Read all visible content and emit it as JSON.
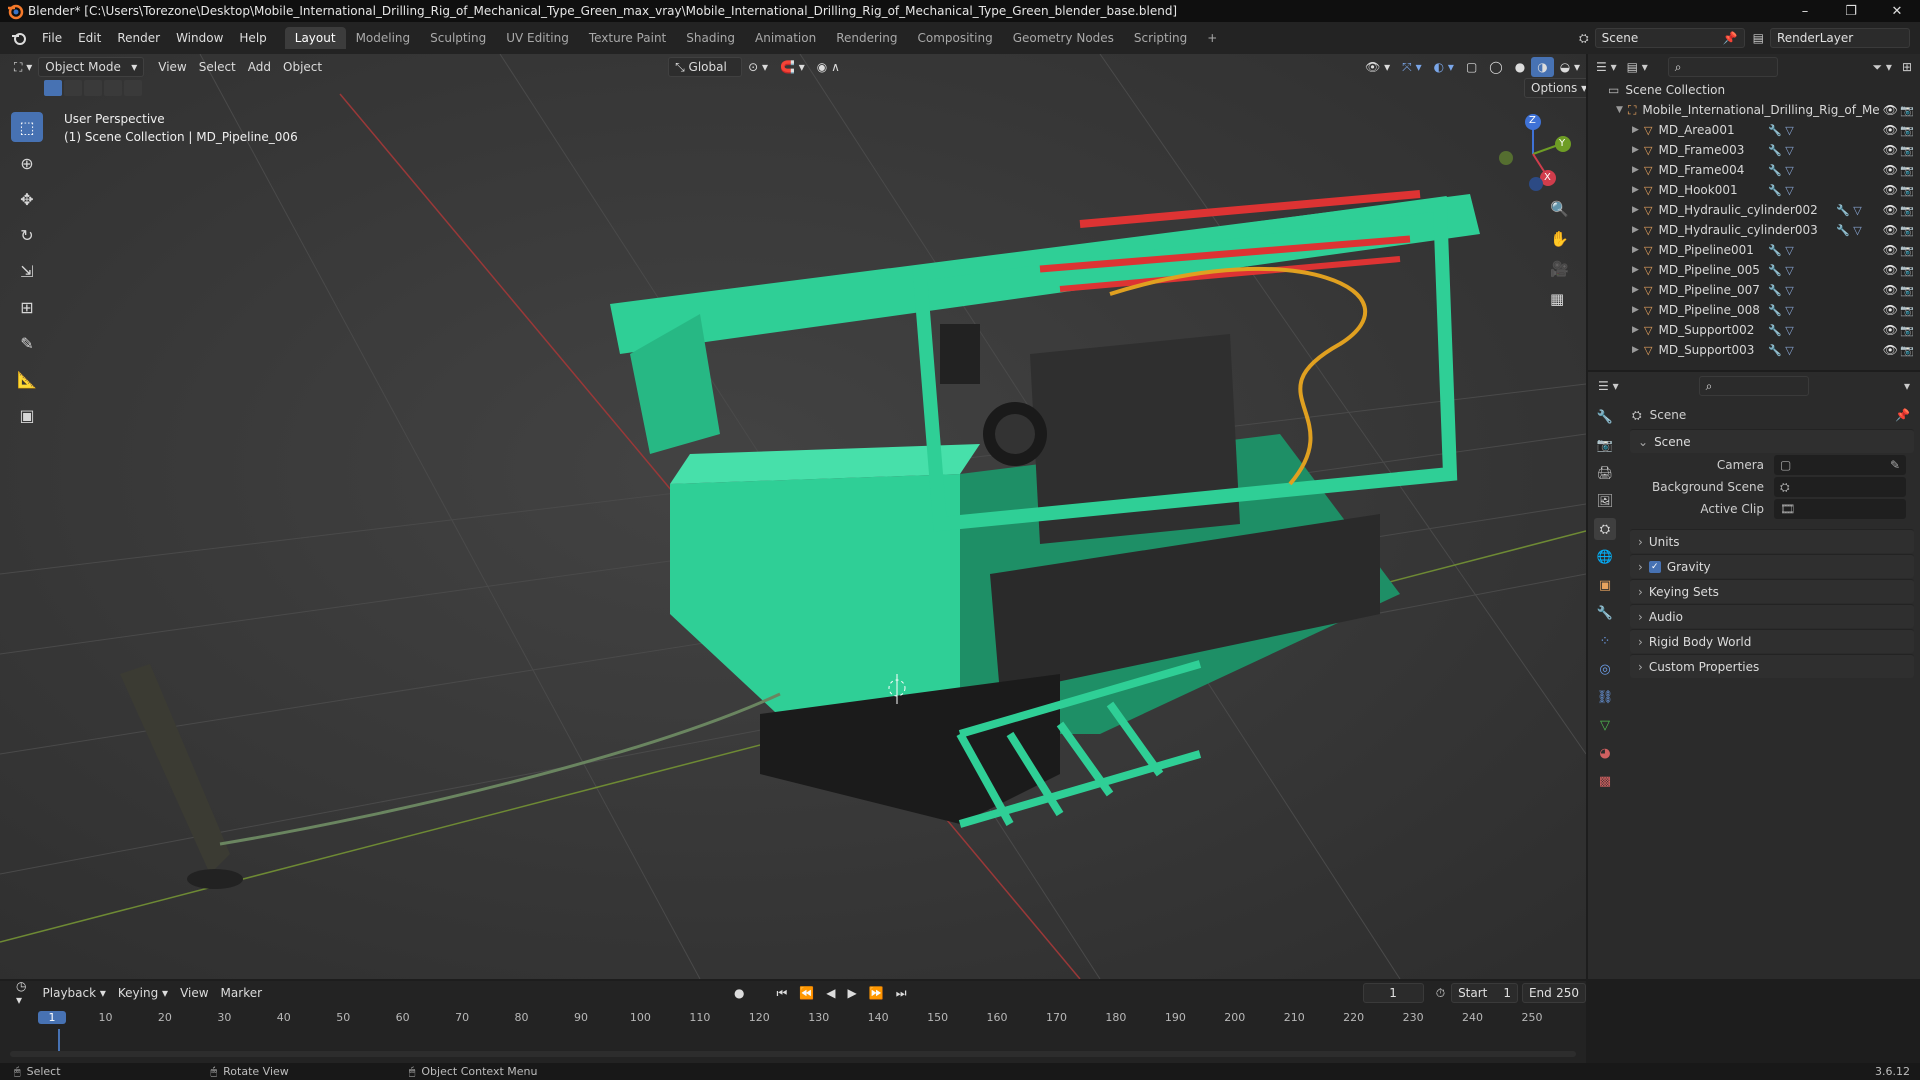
{
  "window": {
    "title": "Blender* [C:\\Users\\Torezone\\Desktop\\Mobile_International_Drilling_Rig_of_Mechanical_Type_Green_max_vray\\Mobile_International_Drilling_Rig_of_Mechanical_Type_Green_blender_base.blend]",
    "minimize": "–",
    "maximize": "❐",
    "close": "✕"
  },
  "menu": [
    "File",
    "Edit",
    "Render",
    "Window",
    "Help"
  ],
  "workspaces": [
    "Layout",
    "Modeling",
    "Sculpting",
    "UV Editing",
    "Texture Paint",
    "Shading",
    "Animation",
    "Rendering",
    "Compositing",
    "Geometry Nodes",
    "Scripting",
    "+"
  ],
  "scene_selector": "Scene",
  "view_layer": "RenderLayer",
  "viewport": {
    "mode": "Object Mode",
    "menus": [
      "View",
      "Select",
      "Add",
      "Object"
    ],
    "orientation": "Global",
    "options": "Options",
    "overlay_line1": "User Perspective",
    "overlay_line2": "(1) Scene Collection | MD_Pipeline_006",
    "gizmo": {
      "x": "X",
      "y": "Y",
      "z": "Z"
    }
  },
  "outliner": {
    "root": "Scene Collection",
    "collection": "Mobile_International_Drilling_Rig_of_Me",
    "items": [
      "MD_Area001",
      "MD_Frame003",
      "MD_Frame004",
      "MD_Hook001",
      "MD_Hydraulic_cylinder002",
      "MD_Hydraulic_cylinder003",
      "MD_Pipeline001",
      "MD_Pipeline_005",
      "MD_Pipeline_007",
      "MD_Pipeline_008",
      "MD_Support002",
      "MD_Support003"
    ]
  },
  "properties": {
    "header": "Scene",
    "section": "Scene",
    "fields": [
      {
        "label": "Camera",
        "value": ""
      },
      {
        "label": "Background Scene",
        "value": ""
      },
      {
        "label": "Active Clip",
        "value": ""
      }
    ],
    "panels": [
      "Units",
      "Gravity",
      "Keying Sets",
      "Audio",
      "Rigid Body World",
      "Custom Properties"
    ],
    "gravity_checked": true
  },
  "timeline": {
    "menus": [
      "Playback",
      "Keying",
      "View",
      "Marker"
    ],
    "current_frame": "1",
    "start_label": "Start",
    "start": "1",
    "end_label": "End",
    "end": "250",
    "ticks": [
      "1",
      "10",
      "20",
      "30",
      "40",
      "50",
      "60",
      "70",
      "80",
      "90",
      "100",
      "110",
      "120",
      "130",
      "140",
      "150",
      "160",
      "170",
      "180",
      "190",
      "200",
      "210",
      "220",
      "230",
      "240",
      "250"
    ]
  },
  "status": {
    "select": "Select",
    "rotate": "Rotate View",
    "context": "Object Context Menu",
    "version": "3.6.12"
  },
  "colors": {
    "accent": "#4772b3",
    "rig_green": "#2fcf96",
    "object_orange": "#e8a35f"
  }
}
